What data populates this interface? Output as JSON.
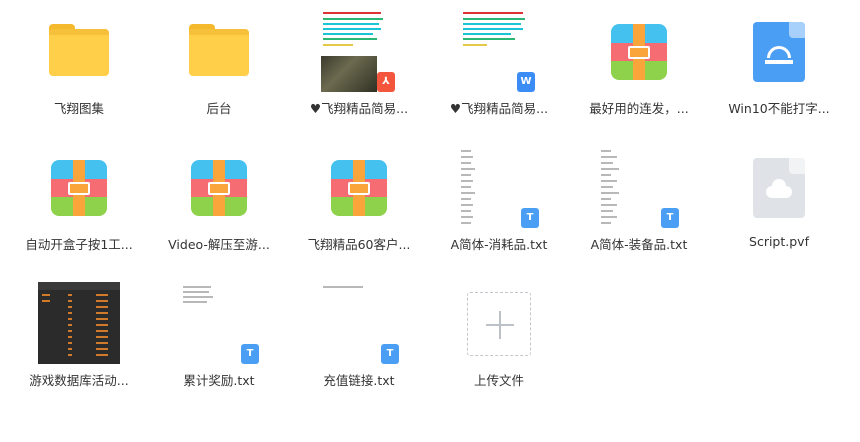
{
  "files": [
    {
      "label": "飞翔图集",
      "type": "folder"
    },
    {
      "label": "后台",
      "type": "folder"
    },
    {
      "label": "♥飞翔精品简易...",
      "type": "pdf"
    },
    {
      "label": "♥飞翔精品简易...",
      "type": "word"
    },
    {
      "label": "最好用的连发，...",
      "type": "archive"
    },
    {
      "label": "Win10不能打字...",
      "type": "document"
    },
    {
      "label": "自动开盒子按1工...",
      "type": "archive"
    },
    {
      "label": "Video-解压至游...",
      "type": "archive"
    },
    {
      "label": "飞翔精品60客户...",
      "type": "archive"
    },
    {
      "label": "A简体-消耗品.txt",
      "type": "txt"
    },
    {
      "label": "A简体-装备品.txt",
      "type": "txt"
    },
    {
      "label": "Script.pvf",
      "type": "unknown"
    },
    {
      "label": "游戏数据库活动...",
      "type": "image"
    },
    {
      "label": "累计奖励.txt",
      "type": "txt"
    },
    {
      "label": "充值链接.txt",
      "type": "txt"
    },
    {
      "label": "上传文件",
      "type": "upload"
    }
  ],
  "badges": {
    "pdf": "⅄",
    "word": "W",
    "txt": "T"
  },
  "colors": {
    "folder": "#ffcf4a",
    "archive_blue": "#45c1f0",
    "archive_red": "#f56d73",
    "archive_green": "#8dd24a",
    "doc_blue": "#4a9ff5",
    "pdf_red": "#f4553d"
  }
}
